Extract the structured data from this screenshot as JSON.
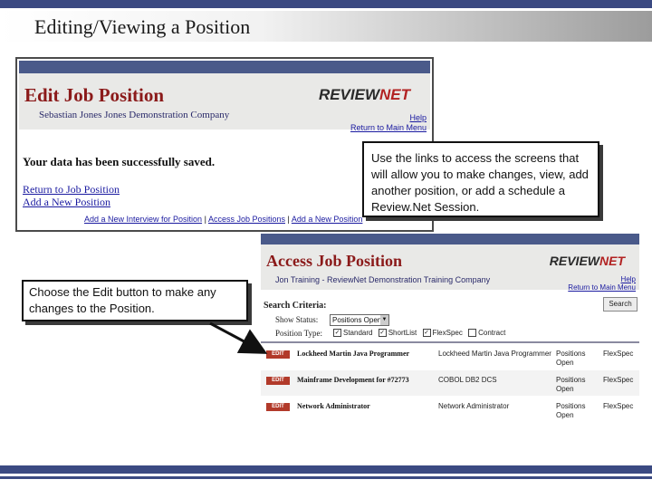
{
  "slide": {
    "title": "Editing/Viewing a Position"
  },
  "edit_screen": {
    "title": "Edit Job Position",
    "subtitle": "Sebastian Jones   Jones Demonstration Company",
    "logo_review": "REVIEW",
    "logo_net": "NET",
    "help_link": "Help",
    "return_link": "Return to Main Menu",
    "saved_message": "Your data has been successfully saved.",
    "return_position_link": "Return to Job Position",
    "add_position_link": "Add a New Position",
    "footer_link1": "Add a New Interview for Position",
    "footer_link2": "Access Job Positions",
    "footer_link3": "Add a New Position",
    "separator": "|"
  },
  "callout_links": "Use the links to access the screens that will allow you to make changes, view, add another position, or add a schedule a Review.Net Session.",
  "access_screen": {
    "title": "Access Job Position",
    "subtitle": "Jon Training - ReviewNet Demonstration Training Company",
    "logo_review": "REVIEW",
    "logo_net": "NET",
    "help_link": "Help",
    "return_link": "Return to Main Menu",
    "search_button": "Search",
    "search_criteria": "Search Criteria:",
    "show_status_label": "Show Status:",
    "show_status_value": "Positions Open",
    "position_type_label": "Position Type:",
    "types": [
      {
        "label": "Standard",
        "checked": true
      },
      {
        "label": "ShortList",
        "checked": true
      },
      {
        "label": "FlexSpec",
        "checked": true
      },
      {
        "label": "Contract",
        "checked": false
      }
    ],
    "edit_label": "EDIT",
    "rows": [
      {
        "name": "Lockheed Martin Java Programmer",
        "desc": "Lockheed Martin Java Programmer",
        "status1": "Positions",
        "status2": "Open",
        "type": "FlexSpec"
      },
      {
        "name": "Mainframe Development for #72773",
        "desc": "COBOL DB2 DCS",
        "status1": "Positions",
        "status2": "Open",
        "type": "FlexSpec"
      },
      {
        "name": "Network Administrator",
        "desc": "Network Administrator",
        "status1": "Positions",
        "status2": "Open",
        "type": "FlexSpec"
      }
    ]
  },
  "callout_edit": "Choose the Edit button to make any changes to the Position."
}
